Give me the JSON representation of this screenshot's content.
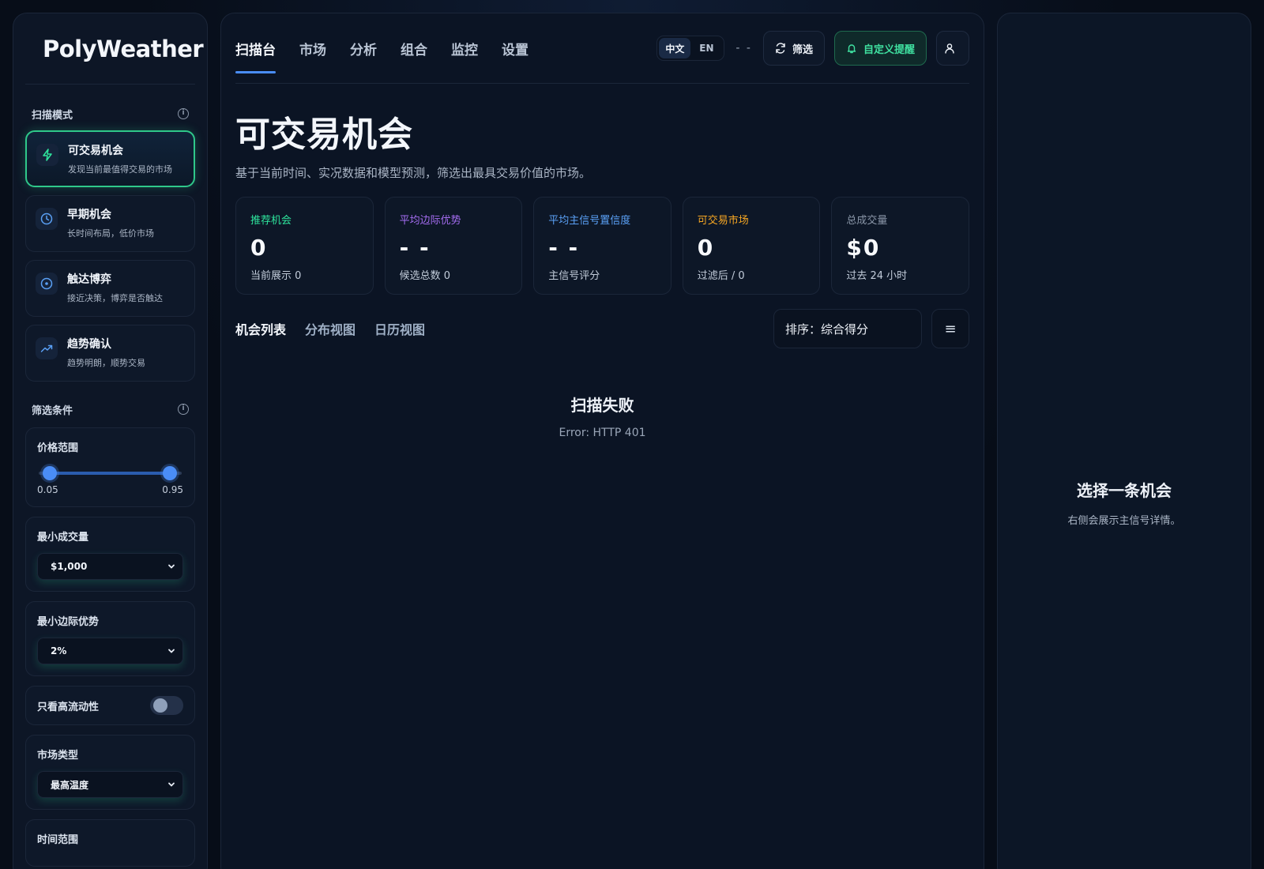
{
  "brand": {
    "name": "PolyWeather",
    "accent": "#2ee59d"
  },
  "sidebar": {
    "scan_mode_label": "扫描模式",
    "modes": [
      {
        "title": "可交易机会",
        "desc": "发现当前最值得交易的市场",
        "icon": "lightning-icon",
        "active": true
      },
      {
        "title": "早期机会",
        "desc": "长时间布局，低价市场",
        "icon": "clock-icon",
        "active": false
      },
      {
        "title": "触达博弈",
        "desc": "接近决策，博弈是否触达",
        "icon": "target-icon",
        "active": false
      },
      {
        "title": "趋势确认",
        "desc": "趋势明朗，顺势交易",
        "icon": "trend-up-icon",
        "active": false
      }
    ],
    "filters_label": "筛选条件",
    "price_range": {
      "label": "价格范围",
      "min": "0.05",
      "max": "0.95"
    },
    "min_volume": {
      "label": "最小成交量",
      "value": "$1,000"
    },
    "min_edge": {
      "label": "最小边际优势",
      "value": "2%"
    },
    "high_liquidity": {
      "label": "只看高流动性",
      "on": false
    },
    "market_type": {
      "label": "市场类型",
      "value": "最高温度"
    },
    "time_range": {
      "label": "时间范围"
    }
  },
  "nav": {
    "tabs": [
      "扫描台",
      "市场",
      "分析",
      "组合",
      "监控",
      "设置"
    ],
    "lang": {
      "zh": "中文",
      "en": "EN"
    },
    "status": "- -",
    "filter_button": "筛选",
    "alert_button": "自定义提醒"
  },
  "main": {
    "title": "可交易机会",
    "subtitle": "基于当前时间、实况数据和模型预测，筛选出最具交易价值的市场。",
    "stats": [
      {
        "label": "推荐机会",
        "value": "0",
        "sub": "当前展示 0",
        "color": "#2ee59d"
      },
      {
        "label": "平均边际优势",
        "value": "- -",
        "sub": "候选总数 0",
        "color": "#a46cf0"
      },
      {
        "label": "平均主信号置信度",
        "value": "- -",
        "sub": "主信号评分",
        "color": "#5aa0f5"
      },
      {
        "label": "可交易市场",
        "value": "0",
        "sub": "过滤后 / 0",
        "color": "#f5a623"
      },
      {
        "label": "总成交量",
        "value": "$0",
        "sub": "过去 24 小时",
        "color": "#8a96a8"
      }
    ],
    "view_tabs": [
      "机会列表",
      "分布视图",
      "日历视图"
    ],
    "sort": "排序：综合得分",
    "empty": {
      "title": "扫描失败",
      "message": "Error: HTTP 401"
    }
  },
  "detail": {
    "title": "选择一条机会",
    "desc": "右侧会展示主信号详情。"
  }
}
